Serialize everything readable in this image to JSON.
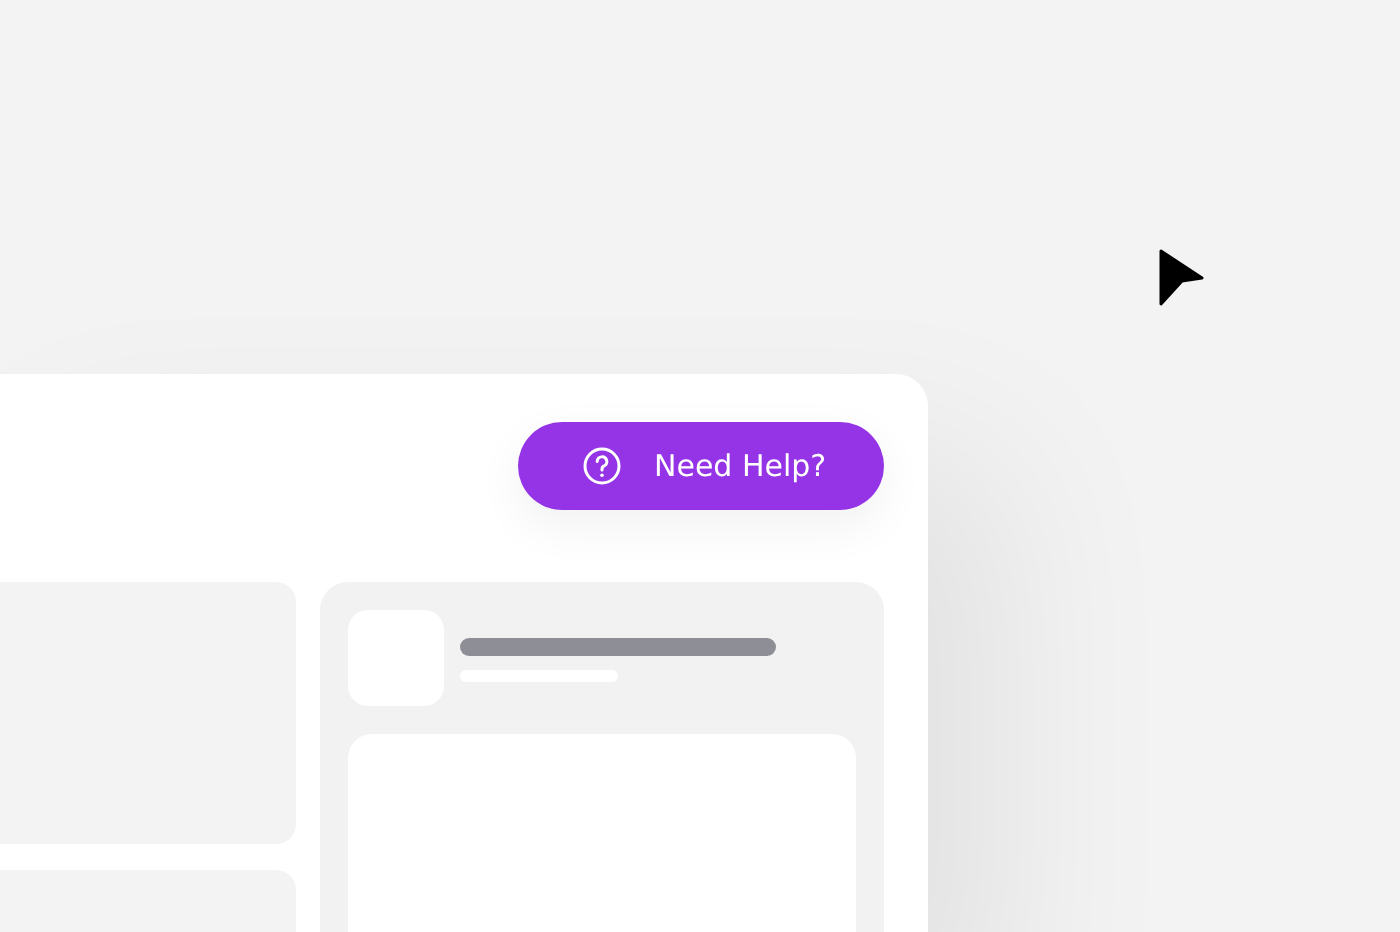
{
  "help_button": {
    "label": "Need Help?"
  }
}
